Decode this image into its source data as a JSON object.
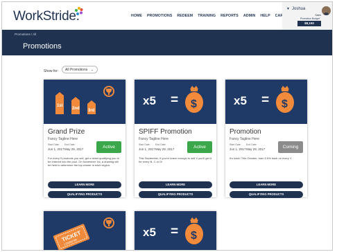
{
  "app": {
    "logo_text": "WorkStride.",
    "nav": [
      "HOME",
      "PROMOTIONS",
      "REDEEM",
      "TRAINING",
      "REPORTS",
      "ADMIN",
      "HELP",
      "CART"
    ],
    "user": {
      "name": "Joshua",
      "subtitle": "Sales",
      "budget_label": "Promotion Budget",
      "budget_value": "$8,150"
    }
  },
  "header": {
    "breadcrumb": "Promotions / All",
    "title": "Promotions"
  },
  "filter": {
    "label": "Show for:",
    "selected": "All Promotions"
  },
  "colors": {
    "navy": "#1f3250",
    "card_image_bg": "#1f3a66",
    "orange": "#f28a3b",
    "active_green": "#3aa84a",
    "coming_gray": "#8c8c8c"
  },
  "cards": [
    {
      "title": "Grand Prize",
      "tagline": "Fancy Tagline Here",
      "start_label": "Start Date:",
      "end_label": "End Date:",
      "start": "Jun 1, 2017",
      "end": "May 29, 2017",
      "status": "Active",
      "description": "For every 5 products you sell, get a ticket qualifying you to be entered into the pool. On November 1st, a drawing will be held to determine the top winner in each region.",
      "icon": "podium-icon",
      "podium": [
        "1st",
        "2nd",
        "3rd"
      ]
    },
    {
      "title": "SPIFF Promotion",
      "tagline": "Fancy Tagline Here",
      "start_label": "Start Date:",
      "end_label": "End Date:",
      "start": "Jun 1, 2017",
      "end": "May 29, 2017",
      "status": "Active",
      "description": "This September, if you're brave enough to sell X you'll get it for every B, C or D!",
      "icon": "money-bag-icon",
      "multiplier": "x5",
      "equals": "="
    },
    {
      "title": "Promotion",
      "tagline": "Fancy Tagline Here",
      "start_label": "Start Date:",
      "end_label": "End Date:",
      "start": "Jun 1, 2017",
      "end": "May 29, 2017",
      "status": "Coming",
      "description": "It's back! This October, earn 0.5% back on every Y.",
      "icon": "money-bag-icon",
      "multiplier": "x5",
      "equals": "="
    }
  ],
  "card_buttons": {
    "learn_more": "LEARN MORE",
    "qualifying": "QUALIFYING PRODUCTS"
  },
  "lower_cards": [
    {
      "icon": "ticket-icon",
      "ticket_text": "TICKET",
      "ticket_number": "123456789"
    },
    {
      "icon": "money-bag-icon",
      "multiplier": "x5",
      "equals": "="
    }
  ]
}
